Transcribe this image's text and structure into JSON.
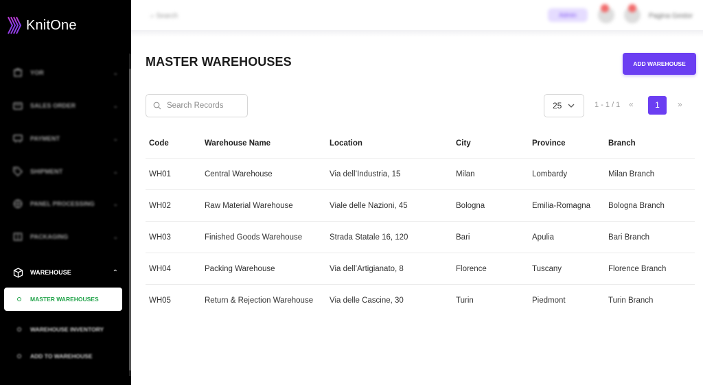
{
  "brand": {
    "name": "KnitOne"
  },
  "sidebar": {
    "items": [
      {
        "label": "YOR",
        "icon": "building-icon"
      },
      {
        "label": "SALES ORDER",
        "icon": "receipt-icon"
      },
      {
        "label": "PAYMENT",
        "icon": "card-icon"
      },
      {
        "label": "SHIPMENT",
        "icon": "tag-icon"
      },
      {
        "label": "PANEL PROCESSING",
        "icon": "globe-icon"
      },
      {
        "label": "PACKAGING",
        "icon": "package-icon"
      },
      {
        "label": "WAREHOUSE",
        "icon": "box-icon",
        "expanded": true
      }
    ],
    "subitems": [
      {
        "label": "MASTER WAREHOUSES",
        "active": true
      },
      {
        "label": "WAREHOUSE INVENTORY",
        "active": false
      },
      {
        "label": "ADD TO WAREHOUSE",
        "active": false
      }
    ]
  },
  "topbar": {
    "search_placeholder": "Search",
    "badge": "Admin",
    "user_name": "Pagina Gestor"
  },
  "main": {
    "title": "MASTER WAREHOUSES",
    "add_button": "ADD WAREHOUSE",
    "search_placeholder": "Search Records",
    "per_page": "25",
    "range": "1 - 1 / 1",
    "prev": "«",
    "current_page": "1",
    "next": "»"
  },
  "table": {
    "columns": [
      "Code",
      "Warehouse Name",
      "Location",
      "City",
      "Province",
      "Branch"
    ],
    "rows": [
      [
        "WH01",
        "Central Warehouse",
        "Via dell’Industria, 15",
        "Milan",
        "Lombardy",
        "Milan Branch"
      ],
      [
        "WH02",
        "Raw Material Warehouse",
        "Viale delle Nazioni, 45",
        "Bologna",
        "Emilia-Romagna",
        "Bologna Branch"
      ],
      [
        "WH03",
        "Finished Goods Warehouse",
        "Strada Statale 16, 120",
        "Bari",
        "Apulia",
        "Bari Branch"
      ],
      [
        "WH04",
        "Packing Warehouse",
        "Via dell’Artigianato, 8",
        "Florence",
        "Tuscany",
        "Florence Branch"
      ],
      [
        "WH05",
        "Return & Rejection Warehouse",
        "Via delle Cascine, 30",
        "Turin",
        "Piedmont",
        "Turin Branch"
      ]
    ]
  },
  "colors": {
    "accent": "#6b3ef2",
    "active_text": "#22a34a",
    "sidebar_bg": "#000000"
  }
}
